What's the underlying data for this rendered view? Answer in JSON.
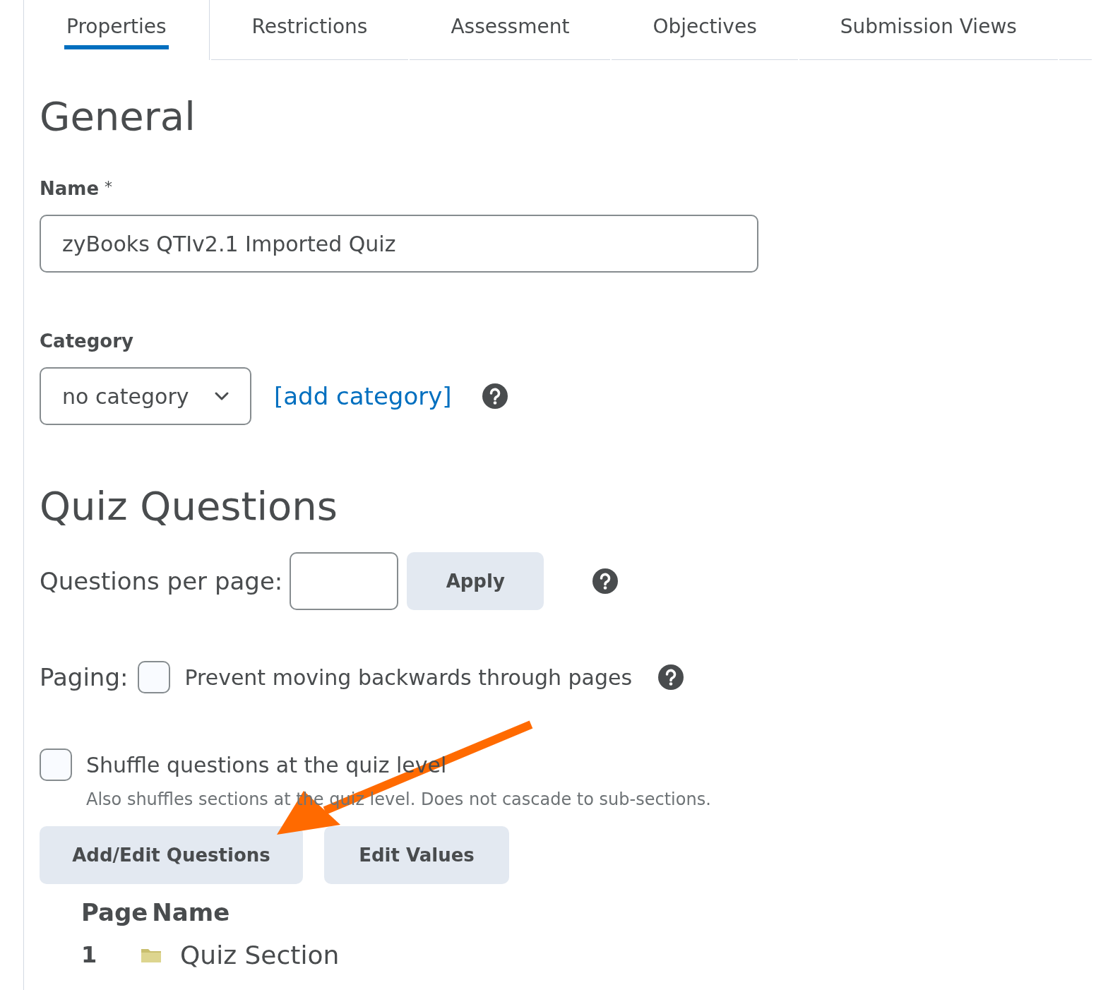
{
  "tabs": [
    {
      "label": "Properties",
      "selected": true
    },
    {
      "label": "Restrictions",
      "selected": false
    },
    {
      "label": "Assessment",
      "selected": false
    },
    {
      "label": "Objectives",
      "selected": false
    },
    {
      "label": "Submission Views",
      "selected": false
    }
  ],
  "general": {
    "heading": "General",
    "name_label": "Name",
    "required_mark": "*",
    "name_value": "zyBooks QTIv2.1 Imported Quiz",
    "category_label": "Category",
    "category_value": "no category",
    "add_category_link": "[add category]"
  },
  "quiz_questions": {
    "heading": "Quiz Questions",
    "per_page_label": "Questions per page:",
    "apply_button": "Apply",
    "paging_label": "Paging:",
    "prevent_backwards": {
      "label": "Prevent moving backwards through pages",
      "checked": false
    },
    "shuffle": {
      "label": "Shuffle questions at the quiz level",
      "checked": false,
      "description": "Also shuffles sections at the quiz level. Does not cascade to sub-sections."
    },
    "buttons": [
      "Add/Edit Questions",
      "Edit Values"
    ],
    "table": {
      "columns": [
        "Page",
        "Name"
      ],
      "rows": [
        {
          "page": "1",
          "name": "Quiz Section"
        }
      ]
    }
  }
}
